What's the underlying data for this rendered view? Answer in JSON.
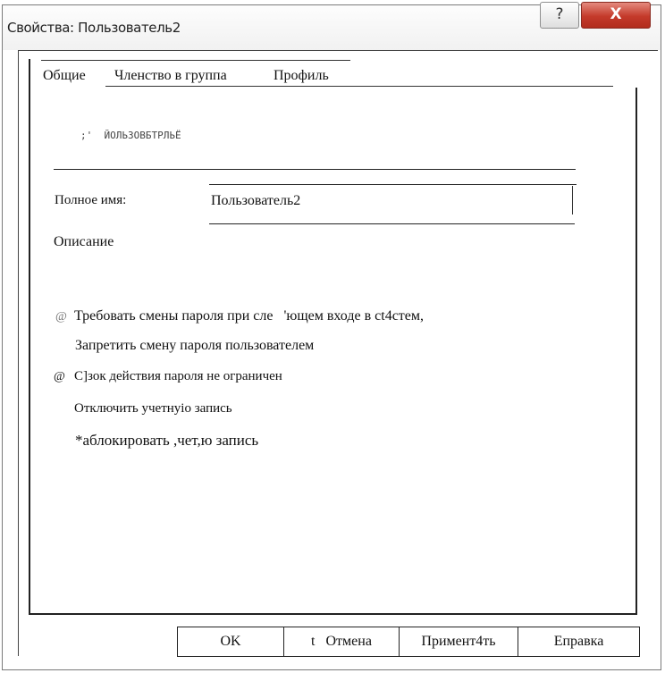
{
  "window": {
    "title": "Свойства: Пользователь2",
    "help_icon": "?",
    "close_icon": "X"
  },
  "tabs": [
    {
      "label": "Общие"
    },
    {
      "label": "Членство в группа"
    },
    {
      "label": "Профиль"
    }
  ],
  "general": {
    "user_name_caption": ";'  ЙОЛЬЗОВБТРЛЬЁ",
    "full_name_label": "Полное имя:",
    "full_name_value": "Пользователь2",
    "description_label": "Описание"
  },
  "options": [
    {
      "marker": "@",
      "label": "Требовать смены пароля при сле   'ющем входе в ct4стем,"
    },
    {
      "marker": "",
      "label": "Запретить смену пароля пользователем"
    },
    {
      "marker": "@",
      "label": "С]зок действия пароля не ограничен"
    },
    {
      "marker": "",
      "label": "Отключить учетнуiо запись"
    },
    {
      "marker": "",
      "label": "*аблокировать ,чет,ю запись"
    }
  ],
  "buttons": {
    "ok": "OK",
    "cancel_prefix": "t",
    "cancel": "Отмена",
    "apply": "Пpимент4ть",
    "help": "Еправка"
  }
}
